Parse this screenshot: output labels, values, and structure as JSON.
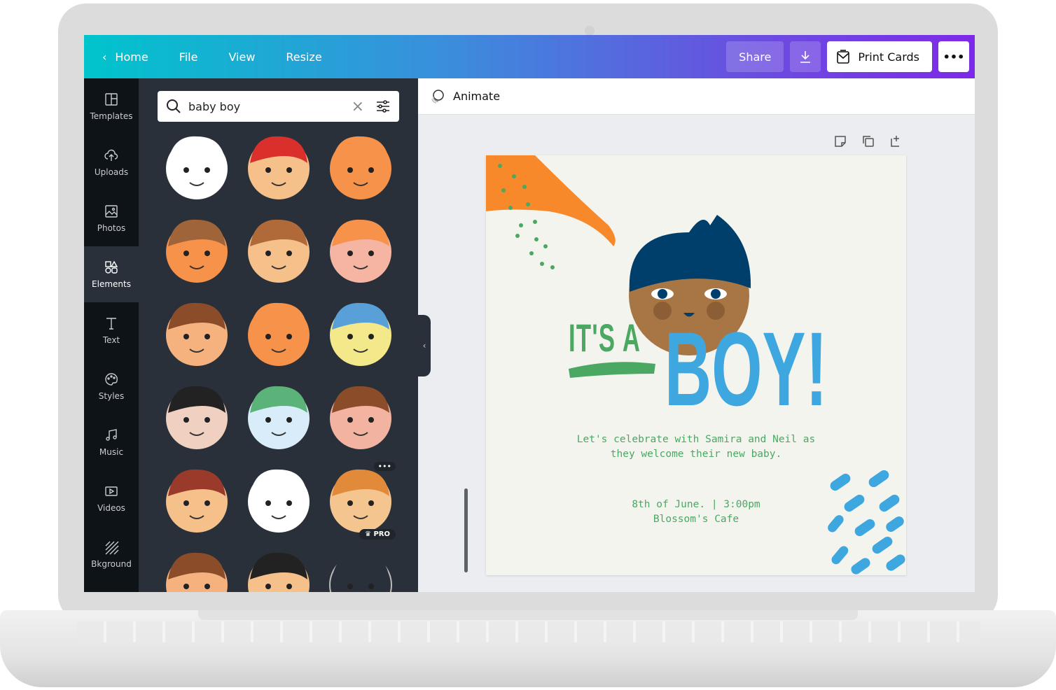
{
  "topbar": {
    "home": "Home",
    "file": "File",
    "view": "View",
    "resize": "Resize",
    "share": "Share",
    "print": "Print Cards",
    "more": "•••"
  },
  "rail": [
    {
      "label": "Templates",
      "icon": "templates-icon"
    },
    {
      "label": "Uploads",
      "icon": "upload-cloud-icon"
    },
    {
      "label": "Photos",
      "icon": "photo-icon"
    },
    {
      "label": "Elements",
      "icon": "shapes-icon",
      "active": true
    },
    {
      "label": "Text",
      "icon": "text-icon"
    },
    {
      "label": "Styles",
      "icon": "palette-icon"
    },
    {
      "label": "Music",
      "icon": "music-icon"
    },
    {
      "label": "Videos",
      "icon": "video-icon"
    },
    {
      "label": "Bkground",
      "icon": "background-icon"
    }
  ],
  "search": {
    "value": "baby boy"
  },
  "elements": [
    {
      "skin": "#ffffff",
      "hair": "#ffffff"
    },
    {
      "skin": "#f5c08a",
      "hair": "#d9302c"
    },
    {
      "skin": "#f7924a",
      "hair": "#f7924a"
    },
    {
      "skin": "#f7924a",
      "hair": "#a0643a"
    },
    {
      "skin": "#f5c08a",
      "hair": "#b06a3a"
    },
    {
      "skin": "#f6b5a3",
      "hair": "#f7924a"
    },
    {
      "skin": "#f5b27e",
      "hair": "#8b4c2a"
    },
    {
      "skin": "#f7924a",
      "hair": "#f7924a"
    },
    {
      "skin": "#f4e98a",
      "hair": "#5aa0d8"
    },
    {
      "skin": "#f0d0c0",
      "hair": "#222222"
    },
    {
      "skin": "#d8ecfa",
      "hair": "#5bb37a"
    },
    {
      "skin": "#f2b4a0",
      "hair": "#8b4c2a"
    },
    {
      "skin": "#f5c08a",
      "hair": "#9a3a2a"
    },
    {
      "skin": "#ffffff",
      "hair": "#ffffff"
    },
    {
      "skin": "#f5c590",
      "hair": "#e08a3a",
      "pro": true
    },
    {
      "skin": "#f5b27e",
      "hair": "#8b4c2a"
    },
    {
      "skin": "#f5c08a",
      "hair": "#222222"
    },
    {
      "skin": "#293039",
      "hair": "#293039"
    }
  ],
  "pro_label": "PRO",
  "more_label": "•••",
  "animate": "Animate",
  "card": {
    "its": "IT'S A",
    "boy": "BOY!",
    "line1": "Let's celebrate with Samira and Neil as",
    "line2": "they welcome their new baby.",
    "line3": "8th of June. | 3:00pm",
    "line4": "Blossom's Cafe",
    "colors": {
      "green": "#4ba862",
      "blue": "#3ea7df",
      "orange": "#f7892a",
      "hair": "#003f6b",
      "skin": "#a87644"
    }
  }
}
